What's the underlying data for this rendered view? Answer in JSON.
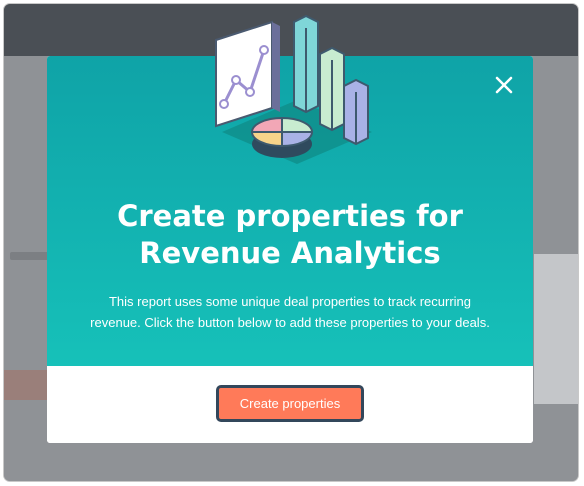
{
  "modal": {
    "title_line1": "Create properties for",
    "title_line2": "Revenue Analytics",
    "description": "This report uses some unique deal properties to track recurring revenue. Click the button below to add these properties to your deals.",
    "cta_label": "Create properties",
    "close_icon": "close-icon",
    "illustration_icon": "analytics-illustration-icon"
  },
  "colors": {
    "header_teal": "#0fa3a7",
    "header_teal_light": "#16c1b9",
    "cta_orange": "#ff7a59",
    "cta_border": "#33475b"
  }
}
